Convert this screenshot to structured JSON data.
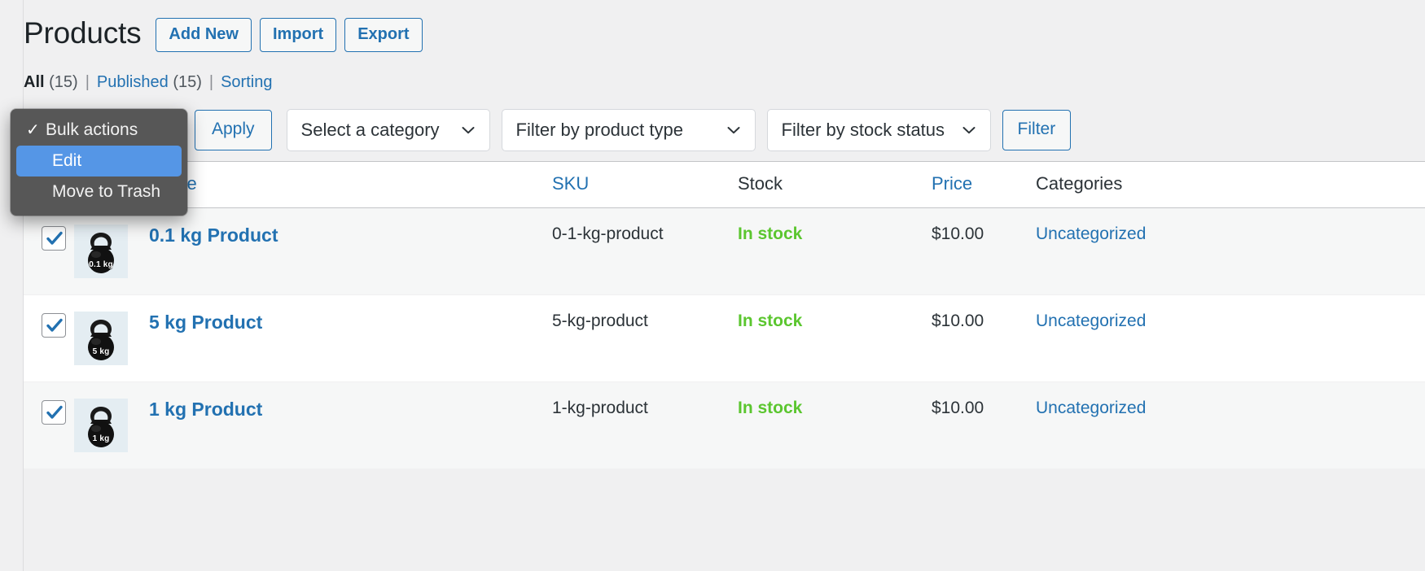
{
  "header": {
    "title": "Products",
    "buttons": [
      {
        "label": "Add New",
        "name": "add-new-button"
      },
      {
        "label": "Import",
        "name": "import-button"
      },
      {
        "label": "Export",
        "name": "export-button"
      }
    ]
  },
  "views": {
    "all_label": "All",
    "all_count": "(15)",
    "sep": "|",
    "published_label": "Published",
    "published_count": "(15)",
    "sorting_label": "Sorting"
  },
  "tablenav": {
    "bulk_actions_value": "Bulk actions",
    "apply_label": "Apply",
    "category_label": "Select a category",
    "product_type_label": "Filter by product type",
    "stock_status_label": "Filter by stock status",
    "filter_label": "Filter"
  },
  "bulk_menu": {
    "open": true,
    "items": [
      {
        "label": "Bulk actions",
        "checked": true,
        "selected": false
      },
      {
        "label": "Edit",
        "checked": false,
        "selected": true
      },
      {
        "label": "Move to Trash",
        "checked": false,
        "selected": false
      }
    ]
  },
  "table": {
    "columns": [
      {
        "label": "",
        "name": "column-checkbox",
        "sortable": false
      },
      {
        "label": "",
        "name": "column-image",
        "sortable": false
      },
      {
        "label": "Name",
        "name": "column-name",
        "sortable": true
      },
      {
        "label": "SKU",
        "name": "column-sku",
        "sortable": true
      },
      {
        "label": "Stock",
        "name": "column-stock",
        "sortable": false
      },
      {
        "label": "Price",
        "name": "column-price",
        "sortable": true
      },
      {
        "label": "Categories",
        "name": "column-categories",
        "sortable": false
      }
    ],
    "rows": [
      {
        "checked": true,
        "thumb_label": "0.1 kg",
        "name": "0.1 kg Product",
        "sku": "0-1-kg-product",
        "stock": "In stock",
        "price": "$10.00",
        "category": "Uncategorized"
      },
      {
        "checked": true,
        "thumb_label": "5 kg",
        "name": "5 kg Product",
        "sku": "5-kg-product",
        "stock": "In stock",
        "price": "$10.00",
        "category": "Uncategorized"
      },
      {
        "checked": true,
        "thumb_label": "1 kg",
        "name": "1 kg Product",
        "sku": "1-kg-product",
        "stock": "In stock",
        "price": "$10.00",
        "category": "Uncategorized"
      }
    ]
  },
  "colors": {
    "link": "#2271b1",
    "in_stock": "#5bc62f",
    "menu_bg": "#575757",
    "menu_highlight": "#5596e6",
    "page_bg": "#f0f0f1"
  },
  "icons": {
    "chevron_down": "chevron-down-icon",
    "check": "check-icon",
    "kettlebell": "kettlebell-icon"
  }
}
